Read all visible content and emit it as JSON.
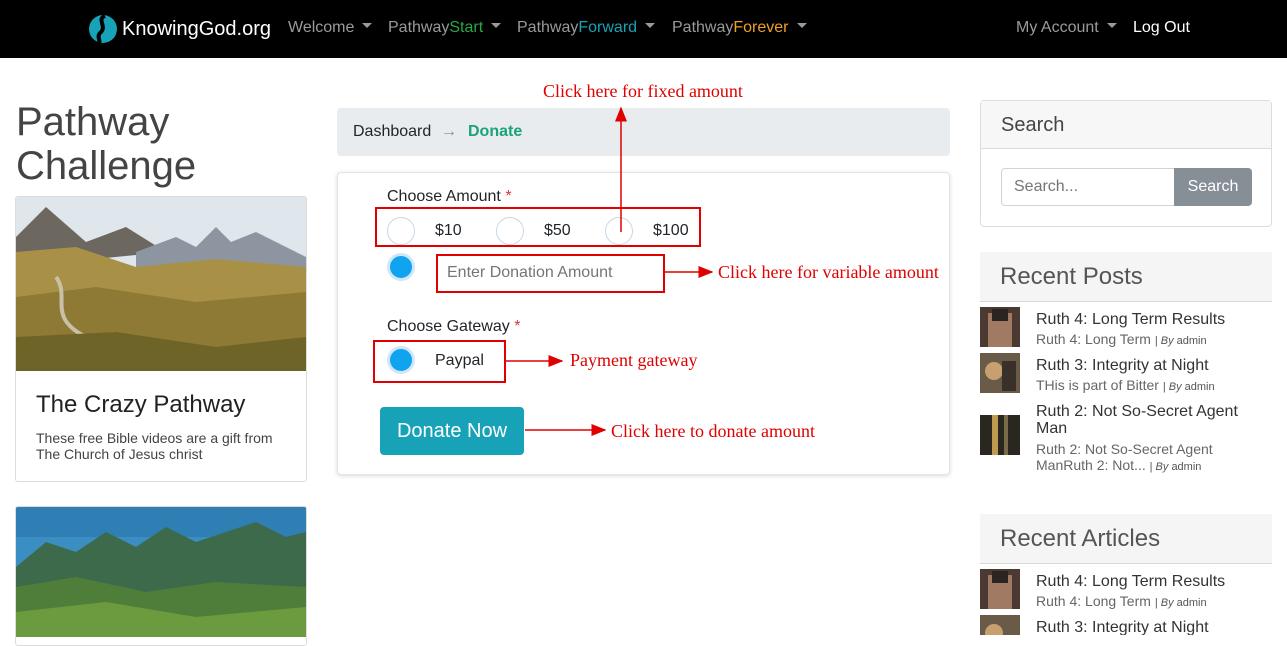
{
  "nav": {
    "brand": "KnowingGod.org",
    "items": [
      {
        "plain": "Welcome",
        "accent": ""
      },
      {
        "plain": "Pathway",
        "accent": "Start"
      },
      {
        "plain": "Pathway",
        "accent": "Forward"
      },
      {
        "plain": "Pathway",
        "accent": "Forever"
      }
    ],
    "account": "My Account",
    "logout": "Log Out"
  },
  "left": {
    "title": "Pathway Challenge",
    "card": {
      "title": "The Crazy Pathway",
      "text": "These free Bible videos are a gift from The Church of Jesus christ"
    }
  },
  "breadcrumb": {
    "home": "Dashboard",
    "arrow": "→",
    "current": "Donate"
  },
  "donate": {
    "amount_label": "Choose Amount",
    "required_mark": "*",
    "amounts": [
      "$10",
      "$50",
      "$100"
    ],
    "amount_placeholder": "Enter Donation Amount",
    "gateway_label": "Choose Gateway",
    "gateway": "Paypal",
    "button": "Donate Now"
  },
  "annotations": {
    "fixed": "Click here for fixed amount",
    "variable": "Click here for variable amount",
    "gateway": "Payment gateway",
    "donate": "Click here to donate amount"
  },
  "sidebar": {
    "search": {
      "title": "Search",
      "placeholder": "Search...",
      "button": "Search"
    },
    "recent_posts": {
      "title": "Recent Posts",
      "items": [
        {
          "title": "Ruth 4: Long Term Results",
          "excerpt": "Ruth 4: Long Term",
          "by": "By",
          "author": "admin"
        },
        {
          "title": "Ruth 3: Integrity at Night",
          "excerpt": "THis is part of Bitter",
          "by": "By",
          "author": "admin"
        },
        {
          "title": "Ruth 2: Not So-Secret Agent Man",
          "excerpt": "Ruth 2: Not So-Secret Agent ManRuth 2: Not...",
          "by": "By",
          "author": "admin"
        }
      ]
    },
    "recent_articles": {
      "title": "Recent Articles",
      "items": [
        {
          "title": "Ruth 4: Long Term Results",
          "excerpt": "Ruth 4: Long Term",
          "by": "By",
          "author": "admin"
        },
        {
          "title": "Ruth 3: Integrity at Night"
        }
      ]
    }
  },
  "colors": {
    "accent_start": "#28a745",
    "accent_forward": "#17a2b8",
    "accent_forever": "#f0a020",
    "annotation": "#e00000",
    "donate_button": "#17a2b8"
  }
}
